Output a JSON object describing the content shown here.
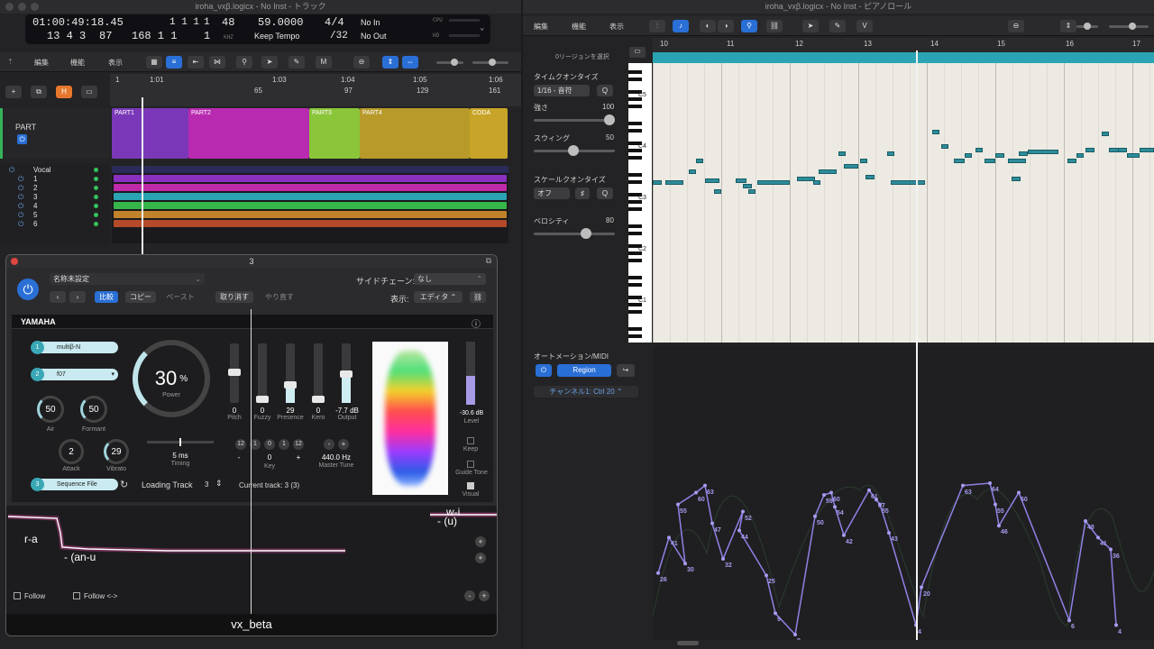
{
  "left_window": {
    "title": "iroha_vxβ.logicx - No Inst - トラック",
    "lcd": {
      "position_time": "01:00:49:18.45",
      "bars_top": "1 1 1",
      "bars_top_sub": "1",
      "tempo_top": "48",
      "bpm": "59.0000",
      "signature": "4/4",
      "in_label": "No In",
      "position_bars": "13 4 3",
      "beat_sub": "87",
      "ticks": "168 1 1",
      "ticks_sub": "1",
      "khz": "KHZ",
      "keep_tempo": "Keep Tempo",
      "division": "/32",
      "out_label": "No Out",
      "cpu": "CPU",
      "hd": "HD"
    },
    "menus": [
      "編集",
      "機能",
      "表示"
    ],
    "toolbar_m": "M",
    "ruler": {
      "bars": [
        "1",
        "1:01",
        "1:03",
        "1:04",
        "1:05",
        "1:06"
      ],
      "numbers": [
        "65",
        "97",
        "129",
        "161"
      ]
    },
    "part_track": {
      "name": "PART",
      "regions": [
        "PART1",
        "PART2",
        "PART3",
        "PART4",
        "CODA"
      ]
    },
    "tracks": [
      {
        "name": "Vocal",
        "num": ""
      },
      {
        "name": "1",
        "num": "1"
      },
      {
        "name": "2",
        "num": "2"
      },
      {
        "name": "3",
        "num": "3"
      },
      {
        "name": "4",
        "num": "4"
      },
      {
        "name": "5",
        "num": "5"
      },
      {
        "name": "6",
        "num": "6"
      }
    ]
  },
  "plugin": {
    "title": "3",
    "preset": "名称未設定",
    "sidechain_label": "サイドチェーン:",
    "sidechain_value": "なし",
    "compare": "比較",
    "copy": "コピー",
    "paste": "ペースト",
    "undo": "取り消す",
    "redo": "やり直す",
    "view_label": "表示:",
    "view_value": "エディタ",
    "brand": "YAMAHA",
    "slot1": {
      "num": "1",
      "name": "multiβ-N"
    },
    "slot2": {
      "num": "2",
      "name": "f07"
    },
    "slot3": {
      "num": "3",
      "name": "Sequence File"
    },
    "air": {
      "value": "50",
      "label": "Air"
    },
    "formant": {
      "value": "50",
      "label": "Formant"
    },
    "attack": {
      "value": "2",
      "label": "Attack"
    },
    "vibrato": {
      "value": "29",
      "label": "Vibrato"
    },
    "power": {
      "value": "30",
      "unit": "%",
      "label": "Power"
    },
    "timing": {
      "value": "5 ms",
      "label": "Timing"
    },
    "pitch": {
      "value": "0",
      "label": "Pitch"
    },
    "fuzzy": {
      "value": "0",
      "label": "Fuzzy"
    },
    "presence": {
      "value": "29",
      "label": "Presence"
    },
    "kero": {
      "value": "0",
      "label": "Kero"
    },
    "output": {
      "value": "-7.7 dB",
      "label": "Output"
    },
    "key": {
      "b1": "12",
      "b2": "1",
      "value": "0",
      "b3": "1",
      "b4": "12",
      "minus": "-",
      "plus": "+",
      "label": "Key"
    },
    "master_tune": {
      "minus": "-",
      "plus": "+",
      "value": "440.0 Hz",
      "label": "Master Tune"
    },
    "level": {
      "value": "-30.6 dB",
      "label": "Level"
    },
    "keep": "Keep",
    "guide_tone": "Guide Tone",
    "visual": "Visual",
    "loading_track_label": "Loading Track",
    "loading_track_value": "3",
    "current_track": "Current track: 3 (3)",
    "lyrics": [
      "r-a",
      "- (an-u",
      "w-i",
      "- (u)"
    ],
    "follow": "Follow",
    "follow2": "Follow <->",
    "footer": "vx_beta",
    "level_fill": 0.45
  },
  "right_window": {
    "title": "iroha_vxβ.logicx - No Inst - ピアノロール",
    "menus": [
      "編集",
      "機能",
      "表示"
    ],
    "region_select": "0リージョンを選択",
    "ruler_bars": [
      "10",
      "11",
      "12",
      "13",
      "14",
      "15",
      "16",
      "17"
    ],
    "time_quantize": "タイムクオンタイズ",
    "quantize_value": "1/16 - 音符",
    "q": "Q",
    "strength_label": "強さ",
    "strength_value": "100",
    "swing_label": "スウィング",
    "swing_value": "50",
    "scale_quantize": "スケールクオンタイズ",
    "scale_value": "オフ",
    "velocity_label": "ベロシティ",
    "velocity_value": "80",
    "octaves": [
      "C5",
      "C4",
      "C3",
      "C2",
      "C1"
    ],
    "automation_label": "オートメーション/MIDI",
    "region_btn": "Region",
    "channel": "チャンネル1: Ctrl 20",
    "points": [
      {
        "v": "26"
      },
      {
        "v": "41"
      },
      {
        "v": "30"
      },
      {
        "v": "55"
      },
      {
        "v": "60"
      },
      {
        "v": "63"
      },
      {
        "v": "47"
      },
      {
        "v": "32"
      },
      {
        "v": "52"
      },
      {
        "v": "44"
      },
      {
        "v": "25"
      },
      {
        "v": "9"
      },
      {
        "v": "0"
      },
      {
        "v": "50"
      },
      {
        "v": "59"
      },
      {
        "v": "60"
      },
      {
        "v": "54"
      },
      {
        "v": "42"
      },
      {
        "v": "61"
      },
      {
        "v": "57"
      },
      {
        "v": "55"
      },
      {
        "v": "43"
      },
      {
        "v": "4"
      },
      {
        "v": "20"
      },
      {
        "v": "63"
      },
      {
        "v": "64"
      },
      {
        "v": "55"
      },
      {
        "v": "46"
      },
      {
        "v": "60"
      },
      {
        "v": "6"
      },
      {
        "v": "48"
      },
      {
        "v": "41"
      },
      {
        "v": "36"
      },
      {
        "v": "4"
      }
    ]
  }
}
